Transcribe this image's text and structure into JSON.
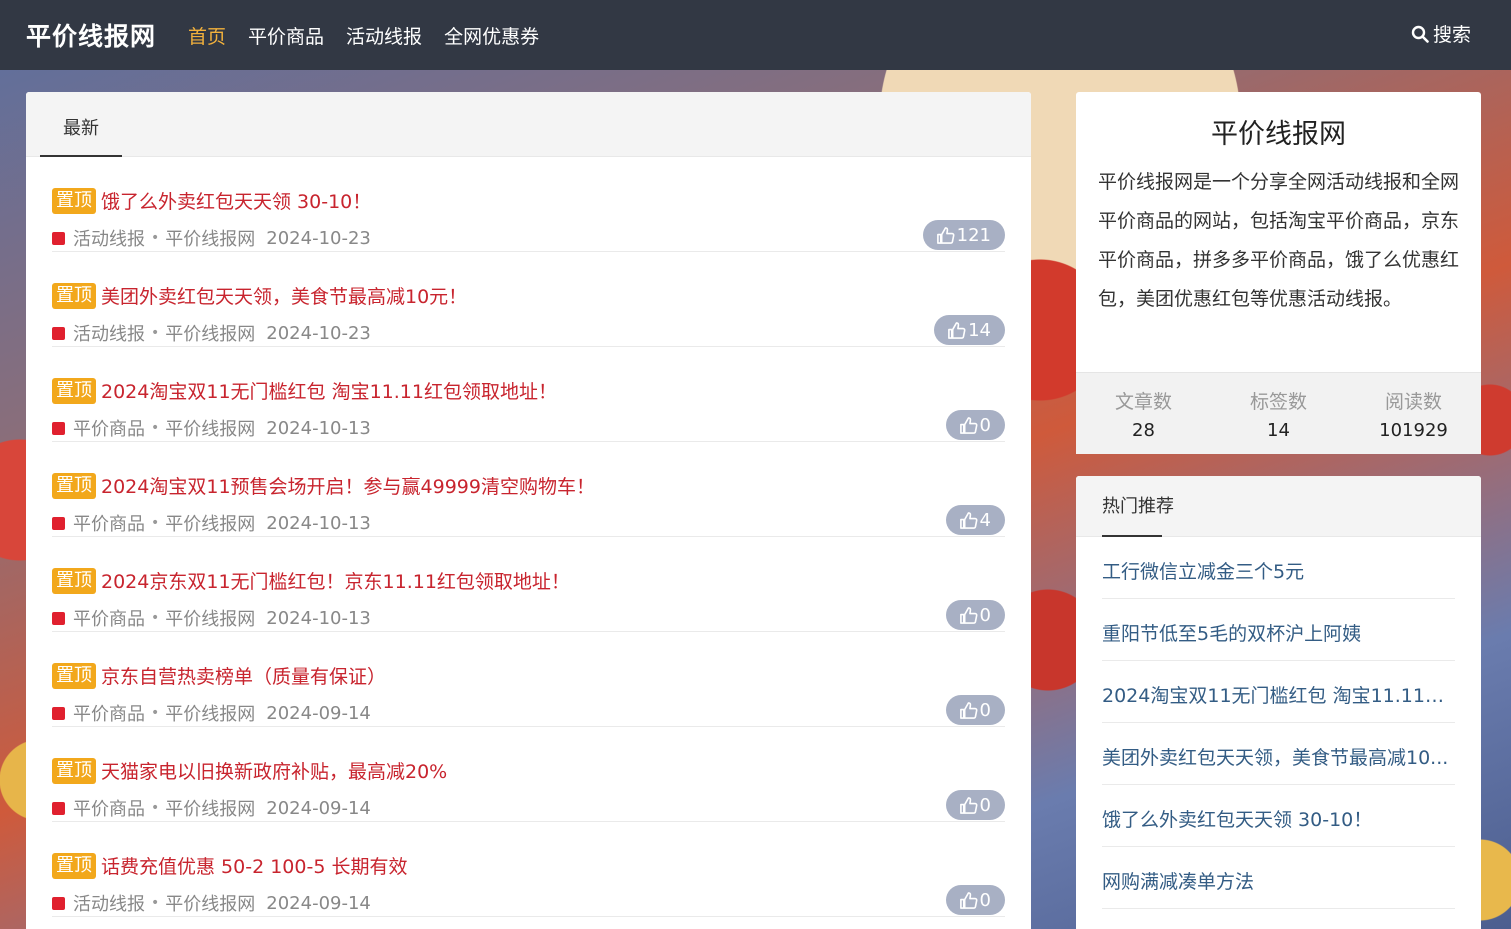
{
  "header": {
    "brand": "平价线报网",
    "nav": [
      "首页",
      "平价商品",
      "活动线报",
      "全网优惠券"
    ],
    "search_label": "搜索"
  },
  "main": {
    "tab_label": "最新",
    "pin_label": "置顶",
    "author": "平价线报网",
    "posts": [
      {
        "title": "饿了么外卖红包天天领 30-10！",
        "category": "活动线报",
        "date": "2024-10-23",
        "likes": "121"
      },
      {
        "title": "美团外卖红包天天领，美食节最高减10元！",
        "category": "活动线报",
        "date": "2024-10-23",
        "likes": "14"
      },
      {
        "title": "2024淘宝双11无门槛红包 淘宝11.11红包领取地址！",
        "category": "平价商品",
        "date": "2024-10-13",
        "likes": "0"
      },
      {
        "title": "2024淘宝双11预售会场开启！参与赢49999清空购物车！",
        "category": "平价商品",
        "date": "2024-10-13",
        "likes": "4"
      },
      {
        "title": "2024京东双11无门槛红包！京东11.11红包领取地址！",
        "category": "平价商品",
        "date": "2024-10-13",
        "likes": "0"
      },
      {
        "title": "京东自营热卖榜单（质量有保证）",
        "category": "平价商品",
        "date": "2024-09-14",
        "likes": "0"
      },
      {
        "title": "天猫家电以旧换新政府补贴，最高减20%",
        "category": "平价商品",
        "date": "2024-09-14",
        "likes": "0"
      },
      {
        "title": "话费充值优惠 50-2 100-5 长期有效",
        "category": "活动线报",
        "date": "2024-09-14",
        "likes": "0"
      }
    ]
  },
  "sidebar": {
    "site_title": "平价线报网",
    "description": "平价线报网是一个分享全网活动线报和全网平价商品的网站，包括淘宝平价商品，京东平价商品，拼多多平价商品，饿了么优惠红包，美团优惠红包等优惠活动线报。",
    "stats": [
      {
        "label": "文章数",
        "value": "28"
      },
      {
        "label": "标签数",
        "value": "14"
      },
      {
        "label": "阅读数",
        "value": "101929"
      }
    ],
    "hot_title": "热门推荐",
    "hot_items": [
      "工行微信立减金三个5元",
      "重阳节低至5毛的双杯沪上阿姨",
      "2024淘宝双11无门槛红包 淘宝11.11红...",
      "美团外卖红包天天领，美食节最高减10...",
      "饿了么外卖红包天天领 30-10！",
      "网购满减凑单方法"
    ]
  },
  "colors": {
    "topbar": "#323844",
    "nav_active": "#f2b13c",
    "pin_bg": "#f2a81c",
    "post_title": "#c8242e",
    "like_bg": "#a8b0c4",
    "hot_link": "#335c84"
  }
}
